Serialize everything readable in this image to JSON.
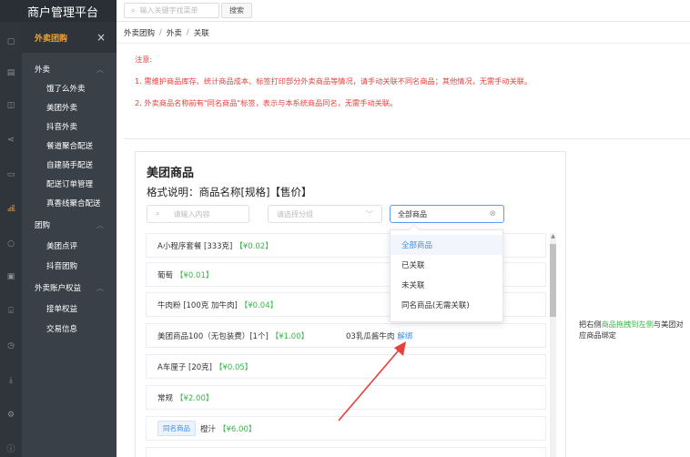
{
  "brand": "商户管理平台",
  "search": {
    "placeholder": "输入关键字找菜单",
    "button": "搜索"
  },
  "menu": {
    "head": "外卖团购",
    "groups": [
      {
        "label": "外卖",
        "items": [
          "饿了么外卖",
          "美团外卖",
          "抖音外卖",
          "餐道聚合配送",
          "自建骑手配送",
          "配送订单管理",
          "真香线聚合配送"
        ]
      },
      {
        "label": "团购",
        "items": [
          "美团点评",
          "抖音团购"
        ]
      },
      {
        "label": "外卖账户权益",
        "items": [
          "接单权益",
          "交易信息"
        ]
      }
    ]
  },
  "breadcrumb": [
    "外卖团购",
    "外卖",
    "关联"
  ],
  "notice": {
    "title": "注意:",
    "line1": "1. 需维护商品库存、统计商品成本、标签打印部分外卖商品等情况，请手动关联不同名商品；其他情况，无需手动关联。",
    "line2": "2. 外卖商品名称前有\"同名商品\"标签，表示与本系统商品同名，无需手动关联。"
  },
  "panel": {
    "title": "美团商品",
    "format": "格式说明：商品名称[规格]【售价】",
    "filter_search_placeholder": "请输入内容",
    "filter_group_placeholder": "请选择分组",
    "filter_status_value": "全部商品",
    "rows": [
      {
        "name": "A小程序套餐 [333克]",
        "price": "【¥0.02】"
      },
      {
        "name": "葡萄",
        "price": "【¥0.01】"
      },
      {
        "name": "牛肉粉 [100克 加牛肉]",
        "price": "【¥0.04】"
      },
      {
        "name": "美团商品100（无包装费）[1个]",
        "price": "【¥1.00】",
        "linked": "03乳瓜酱牛肉",
        "unlink": "解绑"
      },
      {
        "name": "A车厘子 [20克]",
        "price": "【¥0.05】"
      },
      {
        "name": "常规",
        "price": "【¥2.00】"
      },
      {
        "tag": "同名商品",
        "name": "橙汁",
        "price": "【¥6.00】"
      }
    ]
  },
  "dropdown": {
    "options": [
      "全部商品",
      "已关联",
      "未关联",
      "同名商品(无需关联)"
    ],
    "selected": "全部商品"
  },
  "hint": {
    "part1": "把右侧",
    "highlight": "商品拖拽到左侧",
    "part2": "与美团对应商品绑定"
  },
  "colors": {
    "accent": "#f5a623",
    "link": "#3a8ee6",
    "price": "#3ab54a",
    "warning": "#e7413b",
    "sidebar": "#3a4048"
  }
}
